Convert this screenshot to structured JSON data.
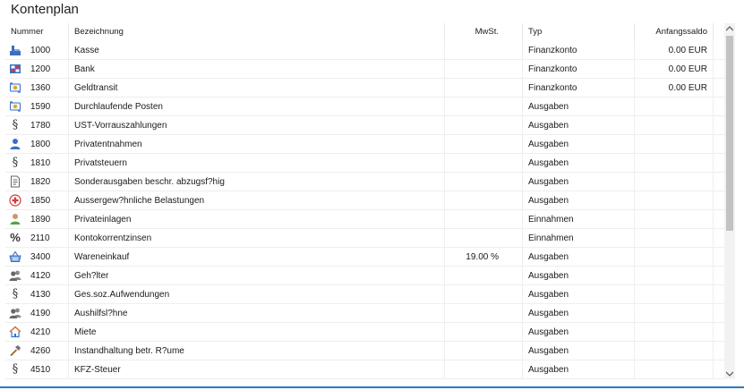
{
  "title": "Kontenplan",
  "columns": {
    "nummer": "Nummer",
    "bezeichnung": "Bezeichnung",
    "mwst": "MwSt.",
    "typ": "Typ",
    "anfangssaldo": "Anfangssaldo"
  },
  "rows": [
    {
      "icon": "cash-register-icon",
      "nummer": "1000",
      "bezeichnung": "Kasse",
      "mwst": "",
      "typ": "Finanzkonto",
      "saldo": "0.00 EUR"
    },
    {
      "icon": "bank-card-icon",
      "nummer": "1200",
      "bezeichnung": "Bank",
      "mwst": "",
      "typ": "Finanzkonto",
      "saldo": "0.00 EUR"
    },
    {
      "icon": "money-transfer-icon",
      "nummer": "1360",
      "bezeichnung": "Geldtransit",
      "mwst": "",
      "typ": "Finanzkonto",
      "saldo": "0.00 EUR"
    },
    {
      "icon": "money-transfer-icon",
      "nummer": "1590",
      "bezeichnung": "Durchlaufende Posten",
      "mwst": "",
      "typ": "Ausgaben",
      "saldo": ""
    },
    {
      "icon": "paragraph-icon",
      "nummer": "1780",
      "bezeichnung": "UST-Vorrauszahlungen",
      "mwst": "",
      "typ": "Ausgaben",
      "saldo": ""
    },
    {
      "icon": "person-icon",
      "nummer": "1800",
      "bezeichnung": "Privatentnahmen",
      "mwst": "",
      "typ": "Ausgaben",
      "saldo": ""
    },
    {
      "icon": "paragraph-icon",
      "nummer": "1810",
      "bezeichnung": "Privatsteuern",
      "mwst": "",
      "typ": "Ausgaben",
      "saldo": ""
    },
    {
      "icon": "document-icon",
      "nummer": "1820",
      "bezeichnung": "Sonderausgaben beschr. abzugsf?hig",
      "mwst": "",
      "typ": "Ausgaben",
      "saldo": ""
    },
    {
      "icon": "medical-icon",
      "nummer": "1850",
      "bezeichnung": "Aussergew?hnliche Belastungen",
      "mwst": "",
      "typ": "Ausgaben",
      "saldo": ""
    },
    {
      "icon": "person-green-icon",
      "nummer": "1890",
      "bezeichnung": "Privateinlagen",
      "mwst": "",
      "typ": "Einnahmen",
      "saldo": ""
    },
    {
      "icon": "percent-icon",
      "nummer": "2110",
      "bezeichnung": "Kontokorrentzinsen",
      "mwst": "",
      "typ": "Einnahmen",
      "saldo": ""
    },
    {
      "icon": "shopping-basket-icon",
      "nummer": "3400",
      "bezeichnung": "Wareneinkauf",
      "mwst": "19.00 %",
      "typ": "Ausgaben",
      "saldo": ""
    },
    {
      "icon": "people-icon",
      "nummer": "4120",
      "bezeichnung": "Geh?lter",
      "mwst": "",
      "typ": "Ausgaben",
      "saldo": ""
    },
    {
      "icon": "paragraph-icon",
      "nummer": "4130",
      "bezeichnung": "Ges.soz.Aufwendungen",
      "mwst": "",
      "typ": "Ausgaben",
      "saldo": ""
    },
    {
      "icon": "people-icon",
      "nummer": "4190",
      "bezeichnung": "Aushilfsl?hne",
      "mwst": "",
      "typ": "Ausgaben",
      "saldo": ""
    },
    {
      "icon": "house-icon",
      "nummer": "4210",
      "bezeichnung": "Miete",
      "mwst": "",
      "typ": "Ausgaben",
      "saldo": ""
    },
    {
      "icon": "hammer-icon",
      "nummer": "4260",
      "bezeichnung": "Instandhaltung betr. R?ume",
      "mwst": "",
      "typ": "Ausgaben",
      "saldo": ""
    },
    {
      "icon": "paragraph-icon",
      "nummer": "4510",
      "bezeichnung": "KFZ-Steuer",
      "mwst": "",
      "typ": "Ausgaben",
      "saldo": ""
    }
  ],
  "colors": {
    "accent": "#2b79c9",
    "icon_blue": "#3a6fc4",
    "icon_red": "#d23b3b",
    "icon_green": "#5a9e4b"
  }
}
